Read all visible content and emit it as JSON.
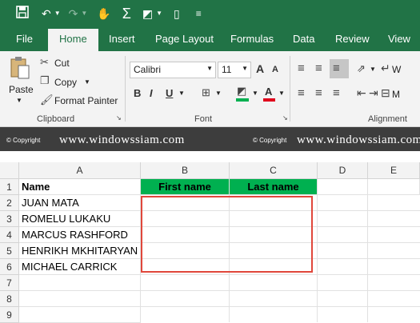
{
  "qat": {
    "icons": [
      "save-icon",
      "undo-icon",
      "redo-icon",
      "touch-icon",
      "autosum-icon",
      "fill-color-icon",
      "new-document-icon",
      "customize-icon"
    ]
  },
  "tabs": [
    "File",
    "Home",
    "Insert",
    "Page Layout",
    "Formulas",
    "Data",
    "Review",
    "View"
  ],
  "clipboard": {
    "paste": "Paste",
    "cut": "Cut",
    "copy": "Copy",
    "format_painter": "Format Painter",
    "group": "Clipboard"
  },
  "font": {
    "name": "Calibri",
    "size": "11",
    "bold": "B",
    "italic": "I",
    "underline": "U",
    "grow": "A",
    "shrink": "A",
    "font_color": "A",
    "group": "Font"
  },
  "alignment": {
    "group": "Alignment",
    "wrap": "W",
    "merge": "M"
  },
  "watermark": {
    "copyright": "© Copyright",
    "url": "www.windowssiam.com"
  },
  "columns": [
    "A",
    "B",
    "C",
    "D",
    "E"
  ],
  "rows": [
    "1",
    "2",
    "3",
    "4",
    "5",
    "6",
    "7",
    "8",
    "9"
  ],
  "cells": {
    "A1": "Name",
    "B1": "First name",
    "C1": "Last name",
    "A2": "JUAN MATA",
    "A3": "ROMELU LUKAKU",
    "A4": "MARCUS RASHFORD",
    "A5": "HENRIKH MKHITARYAN",
    "A6": "MICHAEL CARRICK"
  },
  "colors": {
    "accent": "#217346",
    "header_fill": "#00b050",
    "highlight_border": "#e0473b"
  }
}
